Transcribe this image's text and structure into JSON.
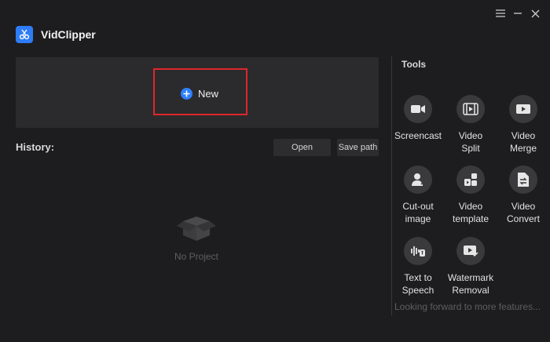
{
  "app": {
    "title": "VidClipper"
  },
  "window_controls": [
    {
      "name": "menu-icon"
    },
    {
      "name": "minimize-icon"
    },
    {
      "name": "close-icon"
    }
  ],
  "new_project": {
    "label": "New",
    "highlight_color": "#e0262a",
    "accent": "#2f80ff"
  },
  "history": {
    "label": "History:",
    "open_label": "Open",
    "save_path_label": "Save path",
    "empty_text": "No Project"
  },
  "tools": {
    "heading": "Tools",
    "items": [
      {
        "label": "Screencast",
        "icon": "camera-icon"
      },
      {
        "label": "Video\nSplit",
        "icon": "film-split-icon"
      },
      {
        "label": "Video\nMerge",
        "icon": "play-merge-icon"
      },
      {
        "label": "Cut-out\nimage",
        "icon": "person-cutout-icon"
      },
      {
        "label": "Video\ntemplate",
        "icon": "template-icon"
      },
      {
        "label": "Video\nConvert",
        "icon": "convert-icon"
      },
      {
        "label": "Text to\nSpeech",
        "icon": "text-speech-icon"
      },
      {
        "label": "Watermark\nRemoval",
        "icon": "watermark-icon"
      }
    ],
    "footer": "Looking forward to more features..."
  }
}
